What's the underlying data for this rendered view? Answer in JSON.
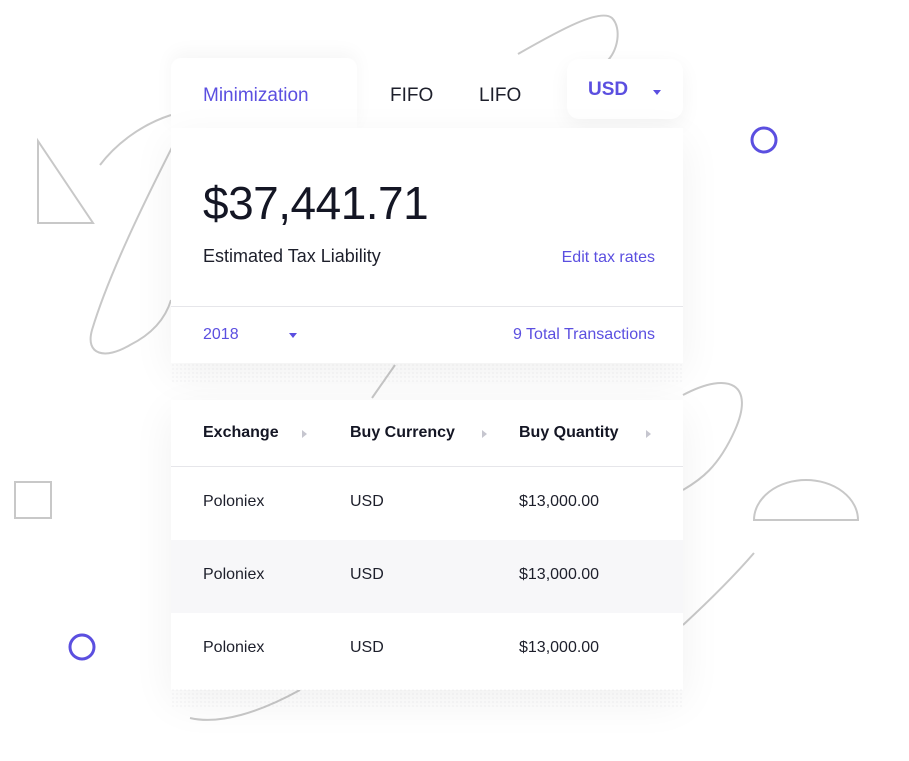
{
  "tabs": {
    "active": "Minimization",
    "fifo": "FIFO",
    "lifo": "LIFO"
  },
  "currency": {
    "selected": "USD"
  },
  "summary": {
    "amount": "$37,441.71",
    "label": "Estimated Tax Liability",
    "edit_link": "Edit tax rates",
    "year": "2018",
    "total_transactions": "9 Total Transactions"
  },
  "table": {
    "columns": [
      "Exchange",
      "Buy Currency",
      "Buy Quantity"
    ],
    "rows": [
      [
        "Poloniex",
        "USD",
        "$13,000.00"
      ],
      [
        "Poloniex",
        "USD",
        "$13,000.00"
      ],
      [
        "Poloniex",
        "USD",
        "$13,000.00"
      ]
    ]
  },
  "colors": {
    "accent": "#5b4fe0",
    "text": "#1d1f2b",
    "decoration": "#c8c8c8"
  },
  "icons": [
    "dropdown-caret-icon",
    "sort-caret-icon"
  ]
}
